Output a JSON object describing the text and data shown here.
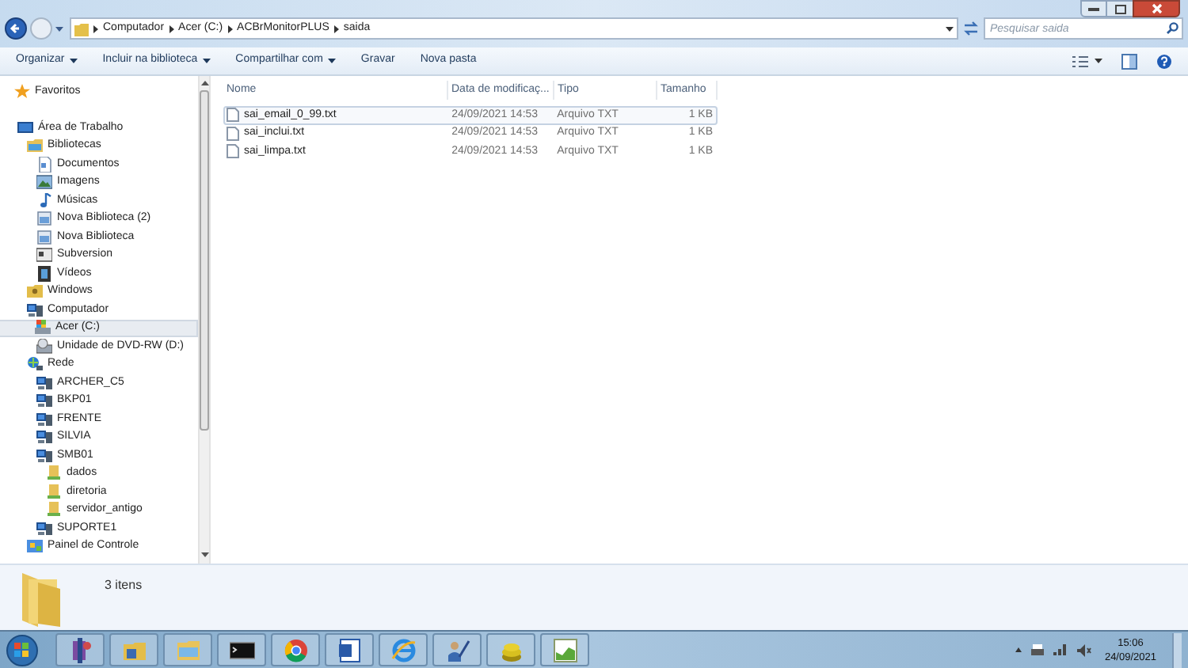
{
  "address_bar": {
    "path": [
      "Computador",
      "Acer (C:)",
      "ACBrMonitorPLUS",
      "saida"
    ]
  },
  "search": {
    "placeholder": "Pesquisar saida"
  },
  "toolbar": [
    {
      "label": "Organizar",
      "dropdown": true
    },
    {
      "label": "Incluir na biblioteca",
      "dropdown": true
    },
    {
      "label": "Compartilhar com",
      "dropdown": true
    },
    {
      "label": "Gravar",
      "dropdown": false
    },
    {
      "label": "Nova pasta",
      "dropdown": false
    }
  ],
  "nav_tree": [
    {
      "label": "Favoritos",
      "kind": "star",
      "selected": false
    },
    {
      "label": "Área de Trabalho",
      "kind": "desktop",
      "selected": false,
      "children": [
        {
          "label": "Bibliotecas",
          "kind": "library",
          "selected": false,
          "children": [
            {
              "label": "Documentos",
              "kind": "document",
              "selected": false
            },
            {
              "label": "Imagens",
              "kind": "image",
              "selected": false
            },
            {
              "label": "Músicas",
              "kind": "music",
              "selected": false
            },
            {
              "label": "Nova Biblioteca (2)",
              "kind": "library-item",
              "selected": false
            },
            {
              "label": "Nova Biblioteca",
              "kind": "library-item",
              "selected": false
            },
            {
              "label": "Subversion",
              "kind": "window",
              "selected": false
            },
            {
              "label": "Vídeos",
              "kind": "video",
              "selected": false
            }
          ]
        },
        {
          "label": "Windows",
          "kind": "user-folder",
          "selected": false
        },
        {
          "label": "Computador",
          "kind": "computer",
          "selected": false,
          "children": [
            {
              "label": "Acer (C:)",
              "kind": "drive",
              "selected": true
            },
            {
              "label": "Unidade de DVD-RW (D:)",
              "kind": "dvd",
              "selected": false
            }
          ]
        },
        {
          "label": "Rede",
          "kind": "network",
          "selected": false,
          "children": [
            {
              "label": "ARCHER_C5",
              "kind": "computer",
              "selected": false
            },
            {
              "label": "BKP01",
              "kind": "computer",
              "selected": false
            },
            {
              "label": "FRENTE",
              "kind": "computer",
              "selected": false
            },
            {
              "label": "SILVIA",
              "kind": "computer",
              "selected": false
            },
            {
              "label": "SMB01",
              "kind": "computer",
              "selected": false,
              "children": [
                {
                  "label": "dados",
                  "kind": "share",
                  "selected": false
                },
                {
                  "label": "diretoria",
                  "kind": "share",
                  "selected": false
                },
                {
                  "label": "servidor_antigo",
                  "kind": "share",
                  "selected": false
                }
              ]
            },
            {
              "label": "SUPORTE1",
              "kind": "computer",
              "selected": false
            }
          ]
        },
        {
          "label": "Painel de Controle",
          "kind": "control-panel",
          "selected": false
        }
      ]
    }
  ],
  "file_list": {
    "columns": [
      "Nome",
      "Data de modificaç...",
      "Tipo",
      "Tamanho"
    ],
    "rows": [
      {
        "name": "sai_email_0_99.txt",
        "date": "24/09/2021 14:53",
        "type": "Arquivo TXT",
        "size": "1 KB",
        "selected": true
      },
      {
        "name": "sai_inclui.txt",
        "date": "24/09/2021 14:53",
        "type": "Arquivo TXT",
        "size": "1 KB",
        "selected": false
      },
      {
        "name": "sai_limpa.txt",
        "date": "24/09/2021 14:53",
        "type": "Arquivo TXT",
        "size": "1 KB",
        "selected": false
      }
    ]
  },
  "status": {
    "count": "3 itens"
  },
  "taskbar": {
    "apps": [
      {
        "kind": "tool"
      },
      {
        "kind": "folder-tool"
      },
      {
        "kind": "explorer"
      },
      {
        "kind": "terminal"
      },
      {
        "kind": "browser"
      },
      {
        "kind": "word"
      },
      {
        "kind": "ie"
      },
      {
        "kind": "person"
      },
      {
        "kind": "coins"
      },
      {
        "kind": "chart"
      }
    ],
    "clock": {
      "time": "15:06",
      "date": "24/09/2021"
    }
  }
}
